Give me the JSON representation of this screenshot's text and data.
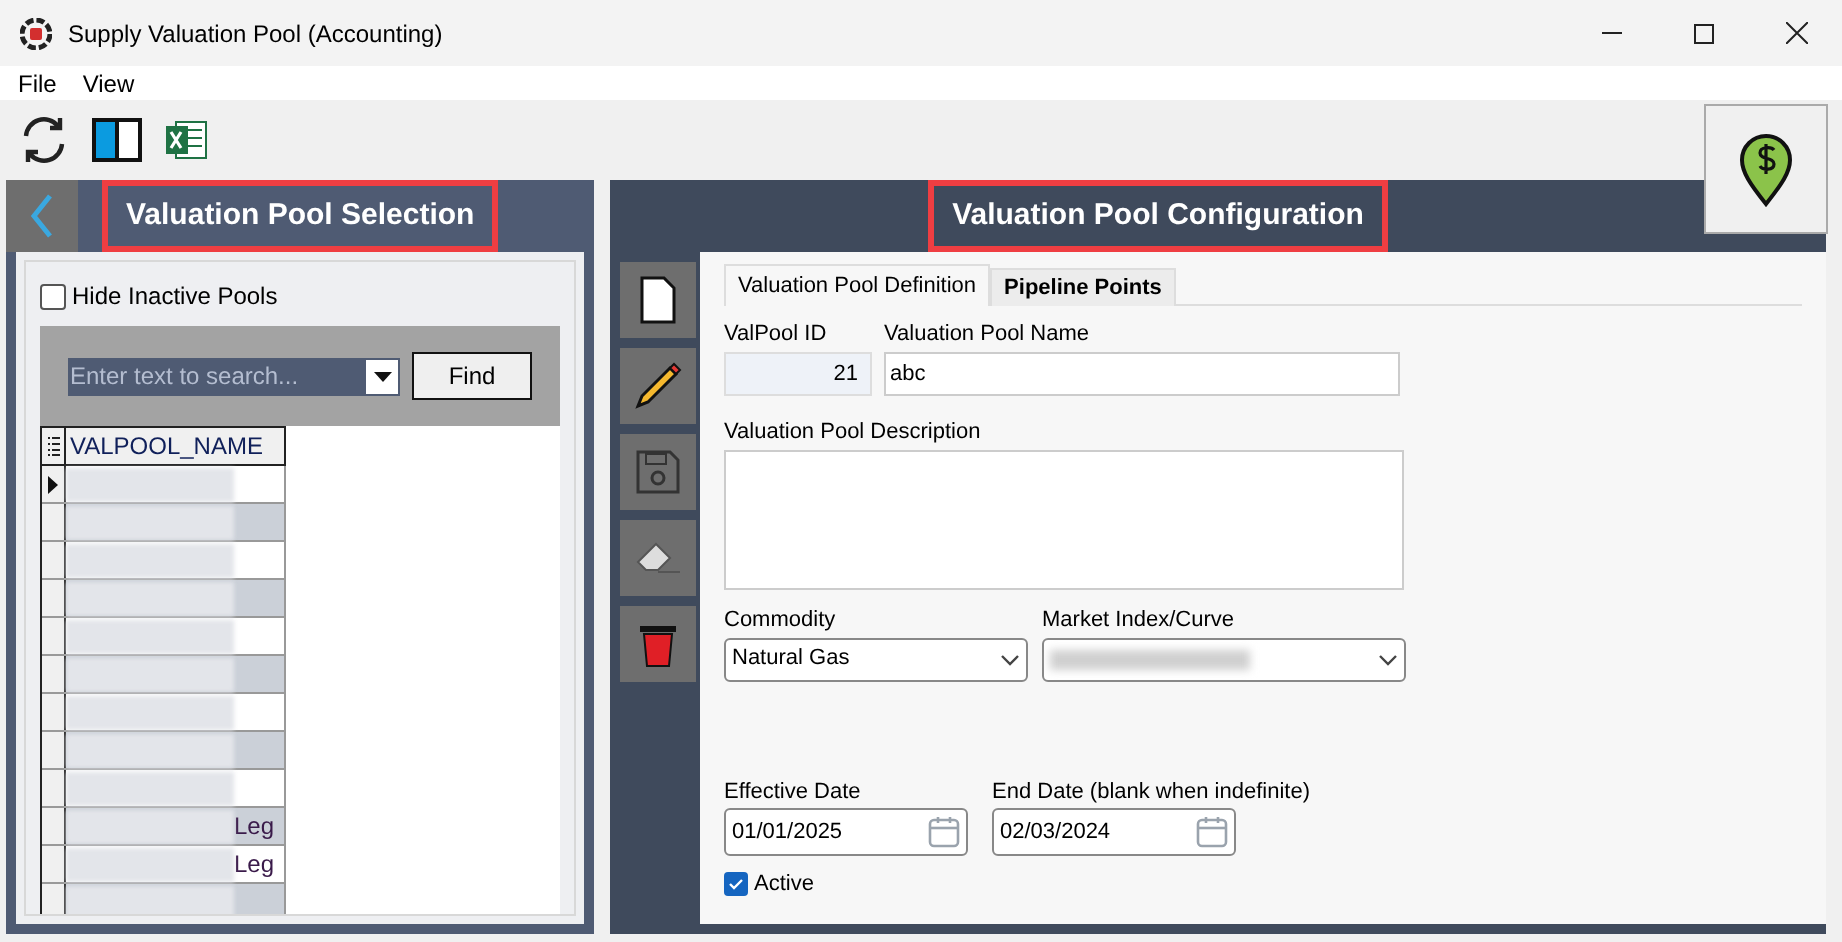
{
  "window": {
    "title": "Supply Valuation Pool (Accounting)"
  },
  "menu": [
    "File",
    "View"
  ],
  "left_panel": {
    "title": "Valuation Pool Selection",
    "hide_inactive": {
      "label": "Hide Inactive Pools",
      "checked": false
    },
    "search": {
      "placeholder": "Enter text to search...",
      "button": "Find"
    },
    "grid": {
      "column": "VALPOOL_NAME",
      "rows": [
        {
          "selected": true
        },
        {
          "selected": false
        },
        {
          "selected": false
        },
        {
          "selected": false
        },
        {
          "selected": false
        },
        {
          "selected": false
        },
        {
          "selected": false
        },
        {
          "selected": false
        },
        {
          "selected": false
        },
        {
          "selected": false,
          "tail": "Leg"
        },
        {
          "selected": false,
          "tail": "Leg"
        },
        {
          "selected": false
        }
      ]
    }
  },
  "right_panel": {
    "title": "Valuation Pool Configuration",
    "tabs": [
      {
        "label": "Valuation Pool Definition",
        "selected": true
      },
      {
        "label": "Pipeline Points",
        "selected": false
      }
    ],
    "form": {
      "id_label": "ValPool ID",
      "id_value": "21",
      "name_label": "Valuation Pool Name",
      "name_value": "abc",
      "description_label": "Valuation Pool Description",
      "commodity_label": "Commodity",
      "commodity_value": "Natural Gas",
      "index_label": "Market Index/Curve",
      "effective_label": "Effective Date",
      "effective_value": "01/01/2025",
      "end_label": "End Date (blank when indefinite)",
      "end_value": "02/03/2024",
      "active": {
        "label": "Active",
        "checked": true
      }
    }
  }
}
